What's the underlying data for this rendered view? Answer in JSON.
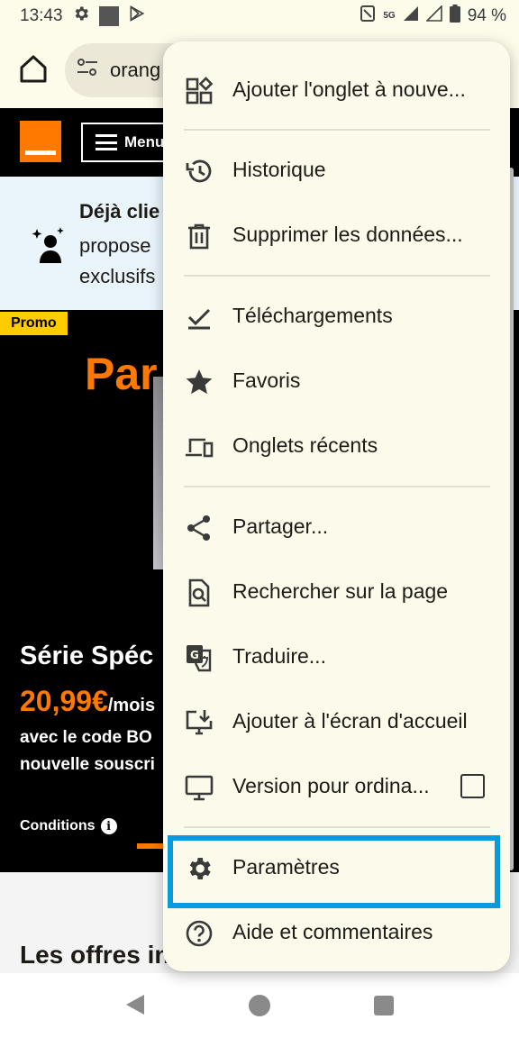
{
  "status_bar": {
    "time": "13:43",
    "network": "5G",
    "battery": "94 %"
  },
  "toolbar": {
    "url_text": "orang"
  },
  "site": {
    "menu_label": "Menu",
    "banner": {
      "title": "Déjà clie",
      "line1": "propose",
      "line2": "exclusifs"
    },
    "promo": {
      "badge": "Promo",
      "title": "Par",
      "serie": "Série Spéc",
      "price": "20,99€",
      "per_month": "/mois",
      "code_line1": "avec le code BO",
      "code_line2": "nouvelle souscri",
      "conditions": "Conditions"
    },
    "offers_title": "Les offres in"
  },
  "menu": {
    "items": [
      {
        "label": "Ajouter l'onglet à nouve...",
        "icon": "add-tab-group-icon"
      },
      {
        "label": "Historique",
        "icon": "history-icon"
      },
      {
        "label": "Supprimer les données...",
        "icon": "trash-icon"
      },
      {
        "label": "Téléchargements",
        "icon": "download-check-icon"
      },
      {
        "label": "Favoris",
        "icon": "star-icon"
      },
      {
        "label": "Onglets récents",
        "icon": "devices-icon"
      },
      {
        "label": "Partager...",
        "icon": "share-icon"
      },
      {
        "label": "Rechercher sur la page",
        "icon": "find-in-page-icon"
      },
      {
        "label": "Traduire...",
        "icon": "translate-icon"
      },
      {
        "label": "Ajouter à l'écran d'accueil",
        "icon": "add-to-home-icon"
      },
      {
        "label": "Version pour ordina...",
        "icon": "desktop-icon",
        "checked": false
      },
      {
        "label": "Paramètres",
        "icon": "gear-icon",
        "highlighted": true
      },
      {
        "label": "Aide et commentaires",
        "icon": "help-icon"
      }
    ]
  },
  "colors": {
    "brand": "#ff7900",
    "highlight": "#0a9bdf",
    "menu_bg": "#fcfaeb"
  }
}
